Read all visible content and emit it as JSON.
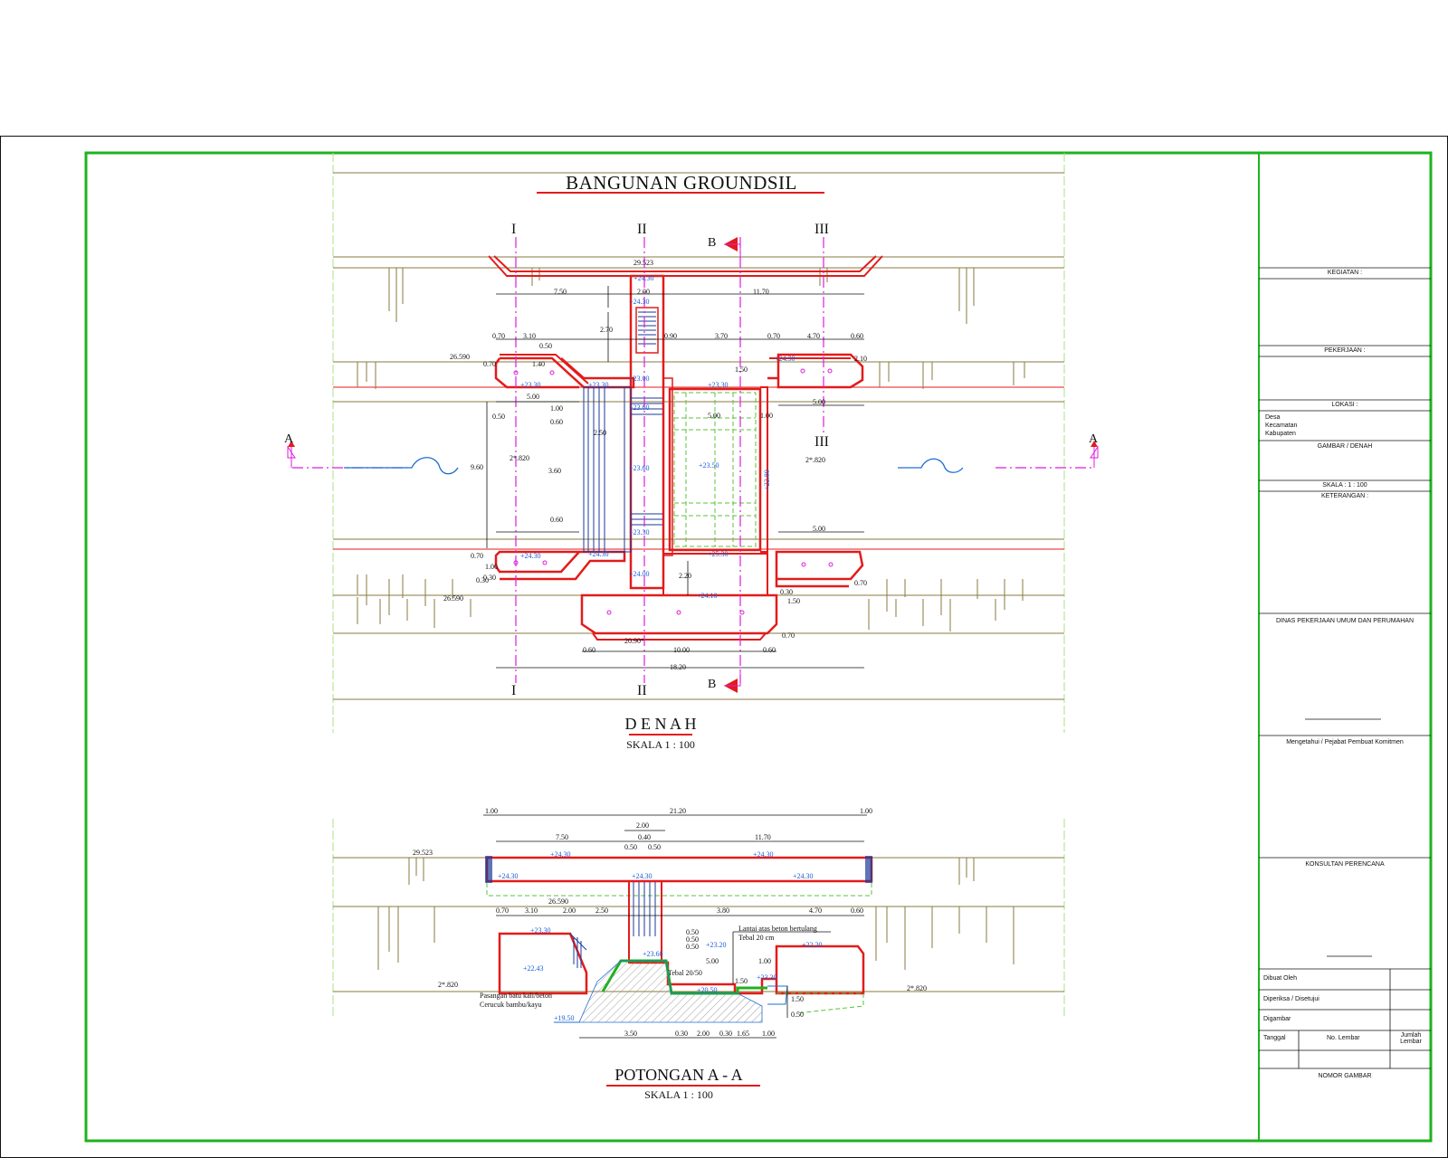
{
  "drawing": {
    "main_title": "BANGUNAN GROUNDSIL",
    "plan_title": "D E N A H",
    "plan_scale": "SKALA 1 : 100",
    "section_title": "POTONGAN  A - A",
    "section_scale": "SKALA 1 : 100",
    "axis_labels": [
      "I",
      "II",
      "III",
      "III",
      "I",
      "II"
    ],
    "section_marks": {
      "a": "A",
      "b": "B"
    },
    "plan_dimensions": [
      "29.523",
      "7.50",
      "2.00",
      "11.70",
      "0.70",
      "3.10",
      "0.90",
      "3.70",
      "0.70",
      "4.70",
      "0.60",
      "2.70",
      "1.50",
      "5.00",
      "1.00",
      "0.60",
      "2.50",
      "9.60",
      "3.60",
      "5.00",
      "5.00",
      "1.00",
      "5.00",
      "0.60",
      "0.70",
      "0.30",
      "2.20",
      "1.50",
      "0.70",
      "0.60",
      "10.00",
      "0.60",
      "18.20",
      "0.50",
      "1.40",
      "1.00",
      "0.50",
      "2.10",
      "0.70",
      "0.30",
      "0.70",
      "0.30"
    ],
    "plan_levels": [
      "+24.30",
      "+24.30",
      "+23.30",
      "+23.30",
      "+23.00",
      "+23.30",
      "+23.60",
      "+23.60",
      "+23.50",
      "+22.80",
      "+24.30",
      "+23.30",
      "+24.30",
      "+24.30",
      "+25.30",
      "+24.00",
      "+24.10"
    ],
    "plan_elevations": [
      "26.590",
      "26.590",
      "2*.820",
      "2*.820",
      "20.90*"
    ],
    "section_dimensions": [
      "1.00",
      "21.20",
      "1.00",
      "2.00",
      "7.50",
      "0.40",
      "11.70",
      "0.50",
      "0.50",
      "0.70",
      "3.10",
      "2.00",
      "2.50",
      "3.80",
      "4.70",
      "0.60",
      "0.50",
      "0.50",
      "0.50",
      "5.00",
      "1.00",
      "1.50",
      "1.50",
      "0.50",
      "3.50",
      "0.30",
      "2.00",
      "0.30",
      "1.65",
      "1.00"
    ],
    "section_levels": [
      "+24.30",
      "+24.30",
      "+24.30",
      "+24.30",
      "+24.30",
      "+23.30",
      "+23.60",
      "+23.20",
      "+22.20",
      "+22.43",
      "+20.50",
      "+23.30",
      "+19.50"
    ],
    "section_elevations": [
      "29.523",
      "26.590",
      "2*.820",
      "2*.820"
    ],
    "section_notes": [
      "Lantai atas beton bertulang",
      "Tebal 20 cm",
      "Tebal 20/50",
      "Pasangan batu kali/beton",
      "Cerucuk bambu/kayu"
    ]
  },
  "title_block": {
    "kegiatan_label": "KEGIATAN :",
    "pekerjaan_label": "PEKERJAAN :",
    "lokasi_label": "LOKASI :",
    "lokasi_lines": [
      "Desa",
      "Kecamatan",
      "Kabupaten"
    ],
    "gambar_label": "GAMBAR / DENAH",
    "skala_label": "SKALA :      1 : 100",
    "keterangan_label": "KETERANGAN :",
    "dinas_label": "DINAS PEKERJAAN UMUM DAN PERUMAHAN",
    "kepala_label": "Mengetahui / Pejabat Pembuat Komitmen",
    "konsultan_label": "KONSULTAN PERENCANA",
    "rows": [
      {
        "label": "Dibuat Oleh",
        "value": ""
      },
      {
        "label": "Diperiksa / Disetujui",
        "value": ""
      },
      {
        "label": "Digambar",
        "value": ""
      }
    ],
    "tanggal_label": "Tanggal",
    "nomor_label": "No. Lembar",
    "jumlah_label": "Jumlah Lembar",
    "footer_label": "NOMOR GAMBAR"
  },
  "colors": {
    "frame": "#1db31d",
    "structure": "#e31b1b",
    "dimension": "#111111",
    "level": "#1a5fd6",
    "axis": "#e01be0",
    "terrain": "#8a7a40",
    "guide": "#a8e28a",
    "hatch": "#1b3a9a",
    "water": "#1e6fd0"
  }
}
